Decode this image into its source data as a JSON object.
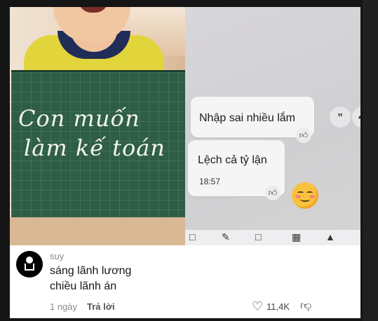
{
  "video": {
    "chalkboard_lines": [
      "Con muốn",
      "làm kế toán"
    ],
    "chat": {
      "message_1": "Nhập sai nhiều lắm",
      "message_2": "Lệch cả tỷ lận",
      "message_2_time": "18:57",
      "like_icon": "thumbs-up-icon",
      "quote_icon": "quote-icon",
      "share_icon": "share-arrow-icon",
      "emoji": "smiling-face-icon"
    }
  },
  "comment": {
    "username": "suy",
    "text_line_1": "sáng lãnh lương",
    "text_line_2": "chiều lãnh án",
    "time": "1 ngày",
    "reply_label": "Trả lời",
    "like_count": "11,4K",
    "heart_icon": "heart-icon",
    "dislike_icon": "thumbs-down-icon"
  }
}
